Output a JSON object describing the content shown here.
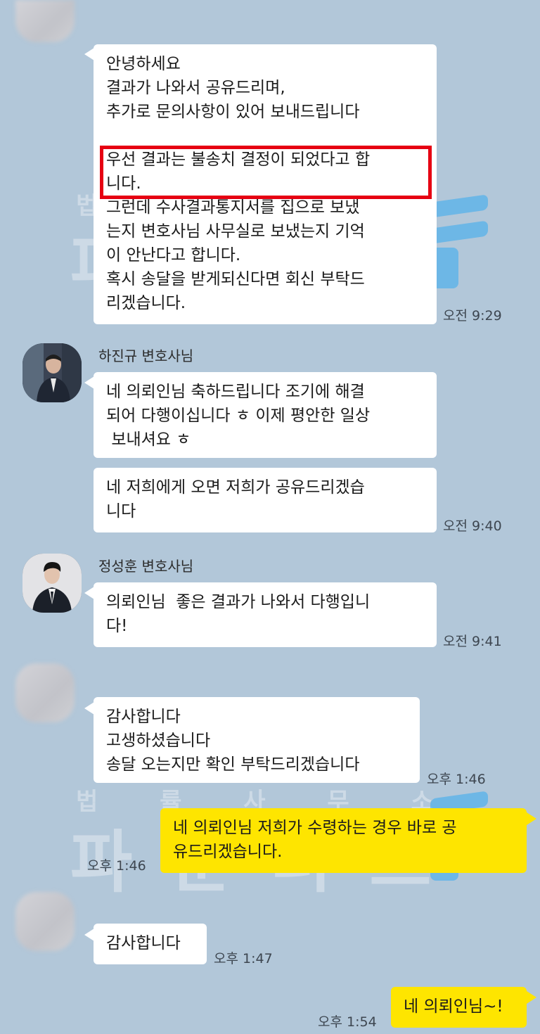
{
  "colors": {
    "background": "#b2c7d9",
    "bubble_other": "#ffffff",
    "bubble_mine": "#fee500",
    "highlight": "#e60012"
  },
  "watermark": {
    "small": "법 률 사 무 소",
    "big": "파 운 더 스"
  },
  "messages": {
    "m1": {
      "text": "안녕하세요\n결과가 나와서 공유드리며,\n추가로 문의사항이 있어 보내드립니다\n\n우선 결과는 불송치 결정이 되었다고 합\n니다.\n그런데 수사결과통지서를 집으로 보냈\n는지 변호사님 사무실로 보냈는지 기억\n이 안난다고 합니다.\n혹시 송달을 받게되신다면 회신 부탁드\n리겠습니다.",
      "time": "오전 9:29"
    },
    "m2_sender": "하진규 변호사님",
    "m2": {
      "text": "네 의뢰인님 축하드립니다 조기에 해결\n되어 다행이십니다 ㅎ 이제 평안한 일상\n 보내셔요 ㅎ"
    },
    "m3": {
      "text": "네 저희에게 오면 저희가 공유드리겠습\n니다",
      "time": "오전 9:40"
    },
    "m4_sender": "정성훈 변호사님",
    "m4": {
      "text": "의뢰인님  좋은 결과가 나와서 다행입니\n다!",
      "time": "오전 9:41"
    },
    "m5": {
      "text": "감사합니다\n고생하셨습니다\n송달 오는지만 확인 부탁드리겠습니다",
      "time": "오후 1:46"
    },
    "m6": {
      "text": "네 의뢰인님 저희가 수령하는 경우 바로 공\n유드리겠습니다.",
      "time": "오후 1:46"
    },
    "m7": {
      "text": "감사합니다",
      "time": "오후 1:47"
    },
    "m8": {
      "text": "네 의뢰인님~!",
      "time": "오후 1:54"
    }
  }
}
